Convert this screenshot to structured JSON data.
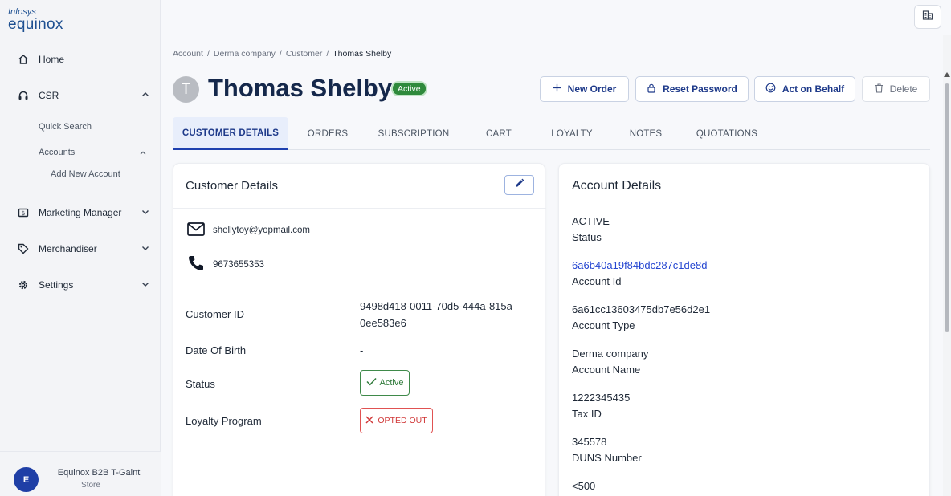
{
  "brand": {
    "top": "Infosys",
    "bottom": "equinox"
  },
  "sidebar": {
    "items": [
      {
        "label": "Home"
      },
      {
        "label": "CSR"
      },
      {
        "label": "Marketing Manager"
      },
      {
        "label": "Merchandiser"
      },
      {
        "label": "Settings"
      }
    ],
    "csr_sub": {
      "quick_search": "Quick Search",
      "accounts": "Accounts",
      "add_new_account": "Add New Account"
    },
    "footer": {
      "avatar": "E",
      "name": "Equinox B2B T-Gaint",
      "sub": "Store"
    }
  },
  "breadcrumb": [
    "Account",
    "Derma company",
    "Customer",
    "Thomas Shelby"
  ],
  "customer": {
    "initial": "T",
    "name": "Thomas Shelby",
    "status_badge": "Active"
  },
  "actions": {
    "new_order": "New Order",
    "reset_password": "Reset Password",
    "act_on_behalf": "Act on Behalf",
    "delete": "Delete"
  },
  "tabs": [
    "CUSTOMER DETAILS",
    "ORDERS",
    "SUBSCRIPTION",
    "CART",
    "LOYALTY",
    "NOTES",
    "QUOTATIONS"
  ],
  "customer_details": {
    "title": "Customer Details",
    "email": "shellytoy@yopmail.com",
    "phone": "9673655353",
    "fields": {
      "customer_id_label": "Customer ID",
      "customer_id_line1": "9498d418-0011-70d5-444a-815a",
      "customer_id_line2": "0ee583e6",
      "dob_label": "Date Of Birth",
      "dob_value": "-",
      "status_label": "Status",
      "status_value": "Active",
      "loyalty_label": "Loyalty Program",
      "loyalty_value": "OPTED OUT"
    }
  },
  "account_details": {
    "title": "Account Details",
    "items": [
      {
        "value": "ACTIVE",
        "label": "Status"
      },
      {
        "value": "6a6b40a19f84bdc287c1de8d",
        "label": "Account Id"
      },
      {
        "value": "6a61cc13603475db7e56d2e1",
        "label": "Account Type"
      },
      {
        "value": "Derma company",
        "label": "Account Name"
      },
      {
        "value": "1222345435",
        "label": "Tax ID"
      },
      {
        "value": "345578",
        "label": "DUNS Number"
      },
      {
        "value": "<500"
      }
    ]
  },
  "colors": {
    "primary": "#1e3a8a",
    "active_green": "#2f8a3c",
    "opted_out_red": "#d03838",
    "link": "#2546d1"
  }
}
